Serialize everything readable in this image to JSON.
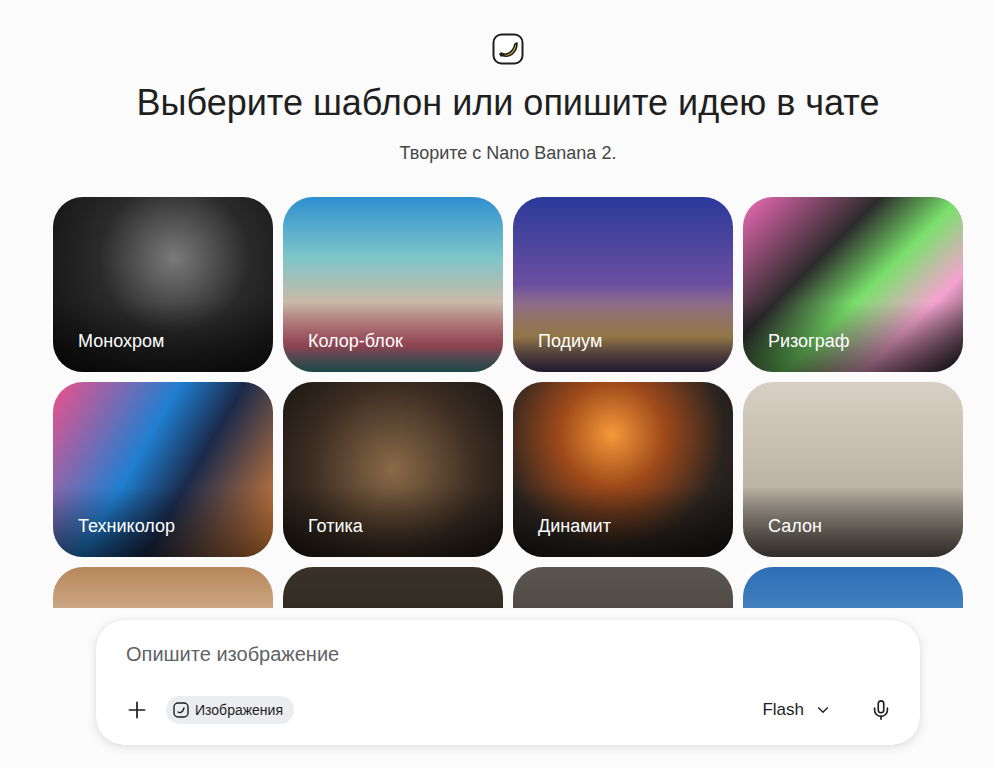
{
  "header": {
    "title": "Выберите шаблон или опишите идею в чате",
    "subtitle": "Творите с Nano Banana 2."
  },
  "templates": [
    {
      "label": "Монохром"
    },
    {
      "label": "Колор-блок"
    },
    {
      "label": "Подиум"
    },
    {
      "label": "Ризограф"
    },
    {
      "label": "Техниколор"
    },
    {
      "label": "Готика"
    },
    {
      "label": "Динамит"
    },
    {
      "label": "Салон"
    },
    {
      "label": ""
    },
    {
      "label": ""
    },
    {
      "label": ""
    },
    {
      "label": ""
    }
  ],
  "composer": {
    "placeholder": "Опишите изображение",
    "chip": "Изображения",
    "model": "Flash"
  }
}
